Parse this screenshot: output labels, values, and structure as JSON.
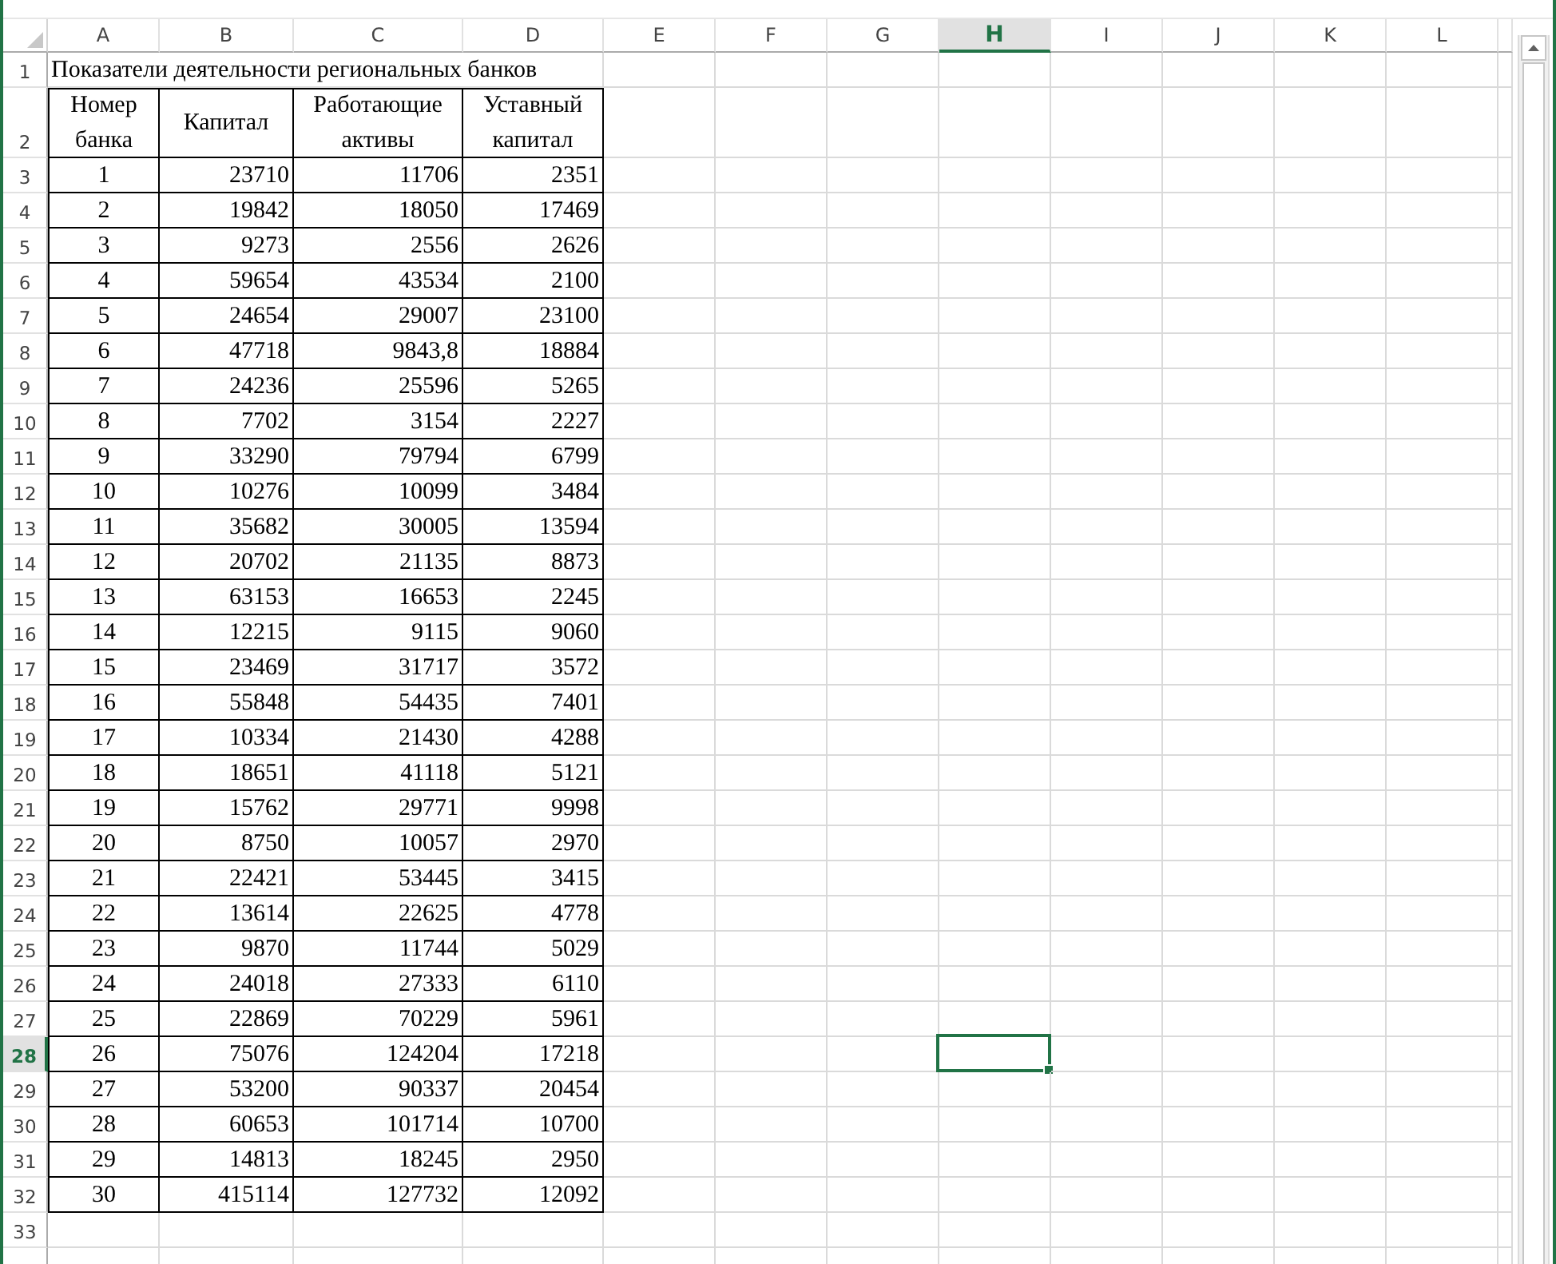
{
  "columns": [
    {
      "label": "A",
      "selected": false
    },
    {
      "label": "B",
      "selected": false
    },
    {
      "label": "C",
      "selected": false
    },
    {
      "label": "D",
      "selected": false
    },
    {
      "label": "E",
      "selected": false
    },
    {
      "label": "F",
      "selected": false
    },
    {
      "label": "G",
      "selected": false
    },
    {
      "label": "H",
      "selected": true
    },
    {
      "label": "I",
      "selected": false
    },
    {
      "label": "J",
      "selected": false
    },
    {
      "label": "K",
      "selected": false
    },
    {
      "label": "L",
      "selected": false
    }
  ],
  "rows": [
    {
      "number": "1",
      "selected": false,
      "kind": "title",
      "cells": [
        "Показатели деятельности региональных банков"
      ]
    },
    {
      "number": "2",
      "selected": false,
      "kind": "header",
      "cells": [
        "Номер банка",
        "Капитал",
        "Работающие активы",
        "Уставный капитал"
      ]
    },
    {
      "number": "3",
      "selected": false,
      "kind": "data",
      "cells": [
        "1",
        "23710",
        "11706",
        "2351"
      ]
    },
    {
      "number": "4",
      "selected": false,
      "kind": "data",
      "cells": [
        "2",
        "19842",
        "18050",
        "17469"
      ]
    },
    {
      "number": "5",
      "selected": false,
      "kind": "data",
      "cells": [
        "3",
        "9273",
        "2556",
        "2626"
      ]
    },
    {
      "number": "6",
      "selected": false,
      "kind": "data",
      "cells": [
        "4",
        "59654",
        "43534",
        "2100"
      ]
    },
    {
      "number": "7",
      "selected": false,
      "kind": "data",
      "cells": [
        "5",
        "24654",
        "29007",
        "23100"
      ]
    },
    {
      "number": "8",
      "selected": false,
      "kind": "data",
      "cells": [
        "6",
        "47718",
        "9843,8",
        "18884"
      ]
    },
    {
      "number": "9",
      "selected": false,
      "kind": "data",
      "cells": [
        "7",
        "24236",
        "25596",
        "5265"
      ]
    },
    {
      "number": "10",
      "selected": false,
      "kind": "data",
      "cells": [
        "8",
        "7702",
        "3154",
        "2227"
      ]
    },
    {
      "number": "11",
      "selected": false,
      "kind": "data",
      "cells": [
        "9",
        "33290",
        "79794",
        "6799"
      ]
    },
    {
      "number": "12",
      "selected": false,
      "kind": "data",
      "cells": [
        "10",
        "10276",
        "10099",
        "3484"
      ]
    },
    {
      "number": "13",
      "selected": false,
      "kind": "data",
      "cells": [
        "11",
        "35682",
        "30005",
        "13594"
      ]
    },
    {
      "number": "14",
      "selected": false,
      "kind": "data",
      "cells": [
        "12",
        "20702",
        "21135",
        "8873"
      ]
    },
    {
      "number": "15",
      "selected": false,
      "kind": "data",
      "cells": [
        "13",
        "63153",
        "16653",
        "2245"
      ]
    },
    {
      "number": "16",
      "selected": false,
      "kind": "data",
      "cells": [
        "14",
        "12215",
        "9115",
        "9060"
      ]
    },
    {
      "number": "17",
      "selected": false,
      "kind": "data",
      "cells": [
        "15",
        "23469",
        "31717",
        "3572"
      ]
    },
    {
      "number": "18",
      "selected": false,
      "kind": "data",
      "cells": [
        "16",
        "55848",
        "54435",
        "7401"
      ]
    },
    {
      "number": "19",
      "selected": false,
      "kind": "data",
      "cells": [
        "17",
        "10334",
        "21430",
        "4288"
      ]
    },
    {
      "number": "20",
      "selected": false,
      "kind": "data",
      "cells": [
        "18",
        "18651",
        "41118",
        "5121"
      ]
    },
    {
      "number": "21",
      "selected": false,
      "kind": "data",
      "cells": [
        "19",
        "15762",
        "29771",
        "9998"
      ]
    },
    {
      "number": "22",
      "selected": false,
      "kind": "data",
      "cells": [
        "20",
        "8750",
        "10057",
        "2970"
      ]
    },
    {
      "number": "23",
      "selected": false,
      "kind": "data",
      "cells": [
        "21",
        "22421",
        "53445",
        "3415"
      ]
    },
    {
      "number": "24",
      "selected": false,
      "kind": "data",
      "cells": [
        "22",
        "13614",
        "22625",
        "4778"
      ]
    },
    {
      "number": "25",
      "selected": false,
      "kind": "data",
      "cells": [
        "23",
        "9870",
        "11744",
        "5029"
      ]
    },
    {
      "number": "26",
      "selected": false,
      "kind": "data",
      "cells": [
        "24",
        "24018",
        "27333",
        "6110"
      ]
    },
    {
      "number": "27",
      "selected": false,
      "kind": "data",
      "cells": [
        "25",
        "22869",
        "70229",
        "5961"
      ]
    },
    {
      "number": "28",
      "selected": true,
      "kind": "data",
      "cells": [
        "26",
        "75076",
        "124204",
        "17218"
      ]
    },
    {
      "number": "29",
      "selected": false,
      "kind": "data",
      "cells": [
        "27",
        "53200",
        "90337",
        "20454"
      ]
    },
    {
      "number": "30",
      "selected": false,
      "kind": "data",
      "cells": [
        "28",
        "60653",
        "101714",
        "10700"
      ]
    },
    {
      "number": "31",
      "selected": false,
      "kind": "data",
      "cells": [
        "29",
        "14813",
        "18245",
        "2950"
      ]
    },
    {
      "number": "32",
      "selected": false,
      "kind": "data",
      "cells": [
        "30",
        "415114",
        "127732",
        "12092"
      ]
    },
    {
      "number": "33",
      "selected": false,
      "kind": "empty",
      "cells": []
    }
  ]
}
